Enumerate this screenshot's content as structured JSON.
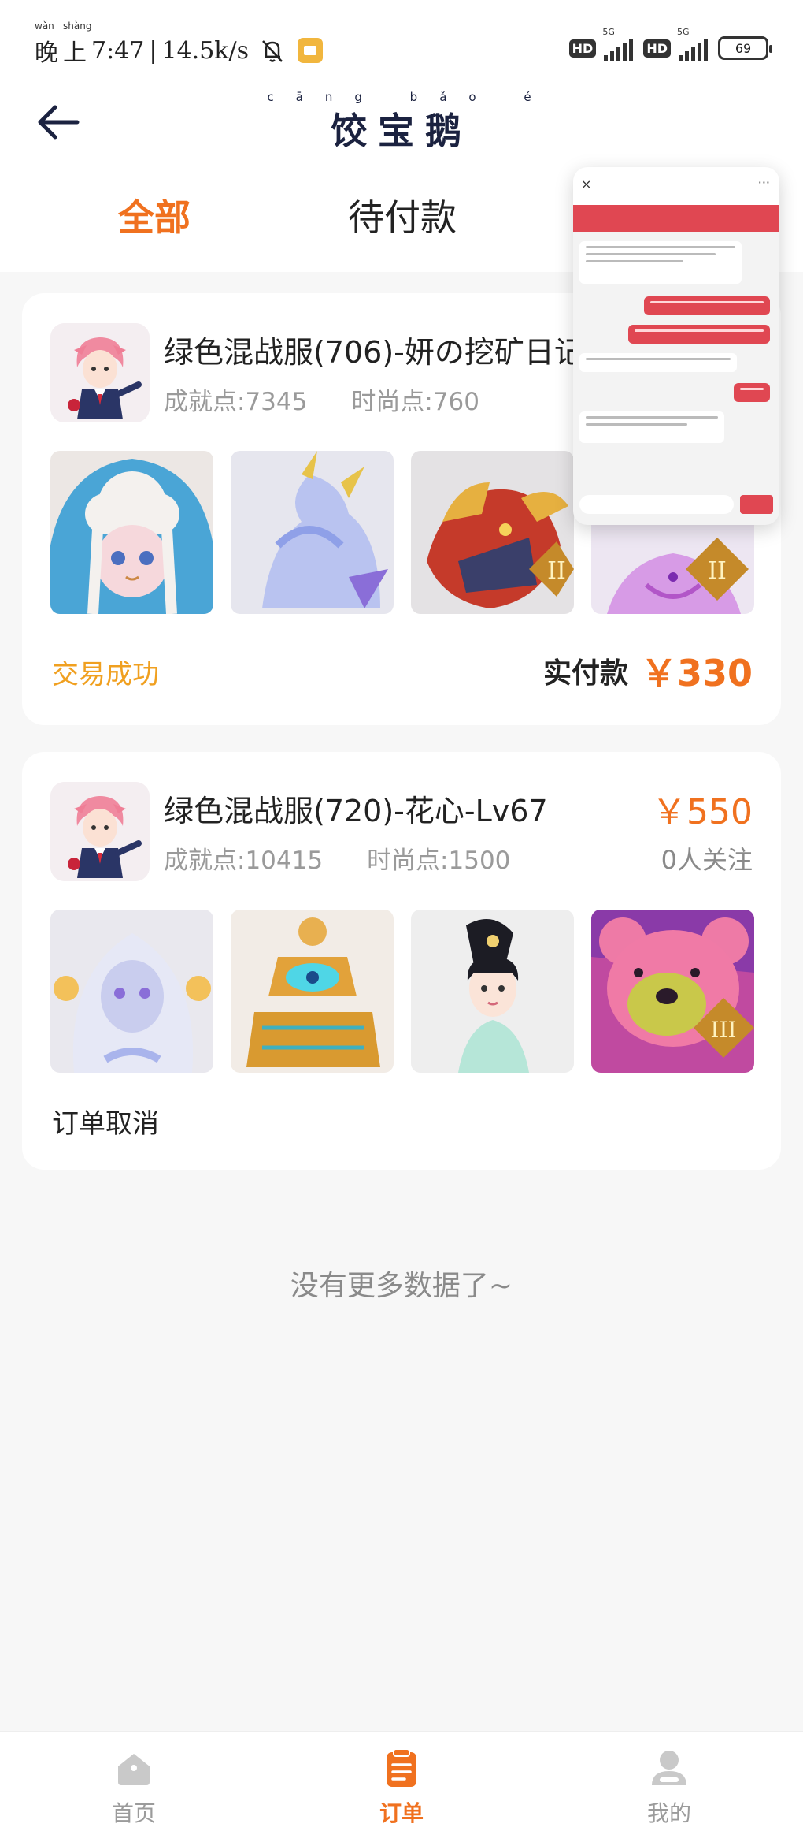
{
  "status_bar": {
    "time_prefix": "晚",
    "time_prefix2": "上",
    "pinyin_1": "wǎn",
    "pinyin_2": "shàng",
    "time": "7:47",
    "speed": "14.5k/s",
    "hd": "HD",
    "net": "5G",
    "battery": "69"
  },
  "header": {
    "title": "饺宝鹅",
    "title_pinyin": "cāng bǎo é"
  },
  "tabs": [
    {
      "label": "全部",
      "active": true
    },
    {
      "label": "待付款",
      "active": false
    }
  ],
  "orders": [
    {
      "title": "绿色混战服(706)-妍の挖矿日记-",
      "achievement": "成就点:7345",
      "fashion": "时尚点:760",
      "status": "交易成功",
      "paid_label": "实付款",
      "paid_amount": "￥330"
    },
    {
      "title": "绿色混战服(720)-花心-Lv67",
      "achievement": "成就点:10415",
      "fashion": "时尚点:1500",
      "price": "￥550",
      "followers": "0人关注",
      "status": "订单取消"
    }
  ],
  "no_more": "没有更多数据了~",
  "overlay": {
    "close": "×",
    "more": "···"
  },
  "bottom_nav": [
    {
      "label": "首页",
      "icon": "home-icon",
      "active": false
    },
    {
      "label": "订单",
      "icon": "orders-icon",
      "active": true
    },
    {
      "label": "我的",
      "icon": "profile-icon",
      "active": false
    }
  ],
  "colors": {
    "accent": "#f0711f",
    "success": "#f0a020",
    "chat_red": "#e04752"
  }
}
